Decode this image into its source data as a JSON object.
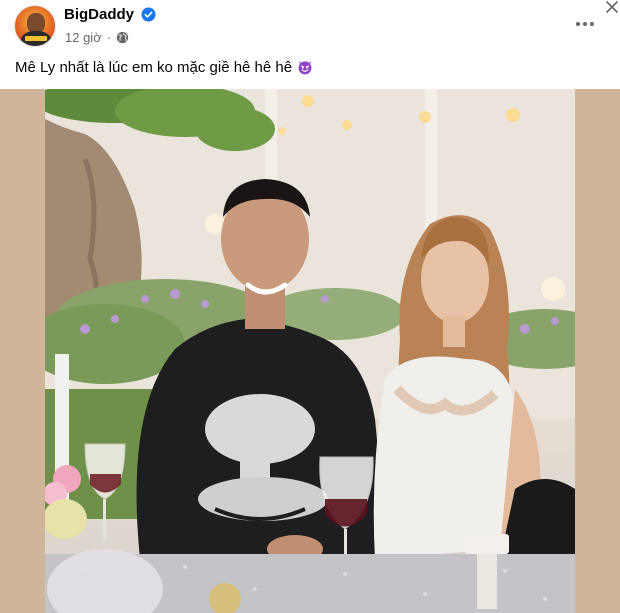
{
  "post": {
    "author": "BigDaddy",
    "time": "12 giờ",
    "separator": "·",
    "caption": "Mê Ly nhất là lúc em ko mặc giề hê hê hê",
    "caption_emoji": "smiling-face-with-horns-icon"
  },
  "icons": {
    "verified": "verified-badge-icon",
    "audience": "globe-icon",
    "more": "more-options-icon",
    "close": "close-icon"
  },
  "colors": {
    "verified_blue": "#1877f2",
    "meta_gray": "#65676b",
    "photo_backdrop": "#cfb69a",
    "emoji_purple": "#8e44c4"
  }
}
